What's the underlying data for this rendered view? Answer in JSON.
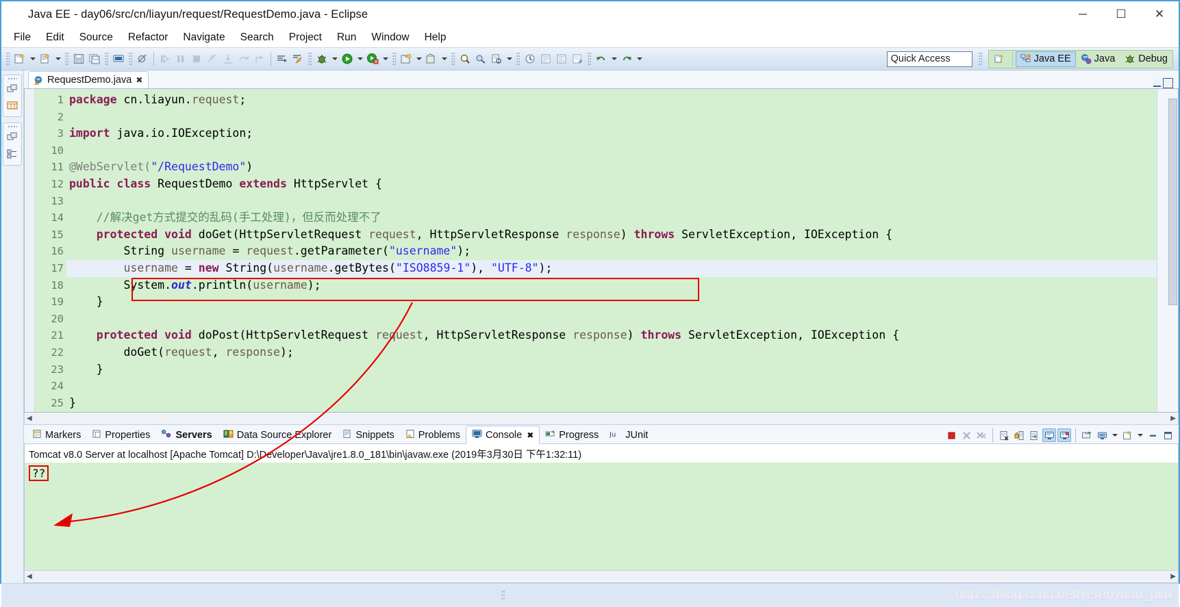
{
  "window": {
    "title": "Java EE - day06/src/cn/liayun/request/RequestDemo.java - Eclipse",
    "icon": "eclipse-icon",
    "minimize": "─",
    "maximize": "☐",
    "close": "✕"
  },
  "menu": {
    "items": [
      "File",
      "Edit",
      "Source",
      "Refactor",
      "Navigate",
      "Search",
      "Project",
      "Run",
      "Window",
      "Help"
    ]
  },
  "toolbar": {
    "quick_access_placeholder": "Quick Access",
    "quick_access_value": "",
    "open_perspective_icon": "open-perspective-icon",
    "perspectives": [
      {
        "label": "Java EE",
        "icon": "java-ee-perspective-icon",
        "active": true
      },
      {
        "label": "Java",
        "icon": "java-perspective-icon",
        "active": false
      },
      {
        "label": "Debug",
        "icon": "debug-perspective-icon",
        "active": false
      }
    ]
  },
  "editor": {
    "tab": {
      "label": "RequestDemo.java",
      "close": "✖",
      "icon": "java-file-warning-icon"
    },
    "minimize": "minimize-icon",
    "maximize": "maximize-icon",
    "current_line": 17,
    "lines": [
      {
        "n": "1",
        "fold": "",
        "text": "package cn.liayun.request;"
      },
      {
        "n": "2",
        "fold": "",
        "text": ""
      },
      {
        "n": "3",
        "fold": "+",
        "text": "import java.io.IOException;"
      },
      {
        "n": "10",
        "fold": "",
        "text": ""
      },
      {
        "n": "11",
        "fold": "",
        "text": "@WebServlet(\"/RequestDemo\")"
      },
      {
        "n": "12",
        "fold": "",
        "text": "public class RequestDemo extends HttpServlet {"
      },
      {
        "n": "13",
        "fold": "",
        "text": ""
      },
      {
        "n": "14",
        "fold": "",
        "text": "    //解决get方式提交的乱码(手工处理)，但反而处理不了"
      },
      {
        "n": "15",
        "fold": "-",
        "text": "    protected void doGet(HttpServletRequest request, HttpServletResponse response) throws ServletException, IOException {"
      },
      {
        "n": "16",
        "fold": "",
        "text": "        String username = request.getParameter(\"username\");"
      },
      {
        "n": "17",
        "fold": "",
        "text": "        username = new String(username.getBytes(\"ISO8859-1\"), \"UTF-8\");"
      },
      {
        "n": "18",
        "fold": "",
        "text": "        System.out.println(username);"
      },
      {
        "n": "19",
        "fold": "",
        "text": "    }"
      },
      {
        "n": "20",
        "fold": "",
        "text": ""
      },
      {
        "n": "21",
        "fold": "-",
        "text": "    protected void doPost(HttpServletRequest request, HttpServletResponse response) throws ServletException, IOException {"
      },
      {
        "n": "22",
        "fold": "",
        "text": "        doGet(request, response);"
      },
      {
        "n": "23",
        "fold": "",
        "text": "    }"
      },
      {
        "n": "24",
        "fold": "",
        "text": ""
      },
      {
        "n": "25",
        "fold": "",
        "text": "}"
      }
    ]
  },
  "bottom_panel": {
    "tabs": [
      {
        "label": "Markers",
        "icon": "markers-icon",
        "active": false,
        "bold": false
      },
      {
        "label": "Properties",
        "icon": "properties-icon",
        "active": false,
        "bold": false
      },
      {
        "label": "Servers",
        "icon": "servers-icon",
        "active": false,
        "bold": true
      },
      {
        "label": "Data Source Explorer",
        "icon": "data-source-explorer-icon",
        "active": false,
        "bold": false
      },
      {
        "label": "Snippets",
        "icon": "snippets-icon",
        "active": false,
        "bold": false
      },
      {
        "label": "Problems",
        "icon": "problems-icon",
        "active": false,
        "bold": false
      },
      {
        "label": "Console",
        "icon": "console-icon",
        "active": true,
        "bold": false
      },
      {
        "label": "Progress",
        "icon": "progress-icon",
        "active": false,
        "bold": false
      },
      {
        "label": "JUnit",
        "icon": "junit-icon",
        "active": false,
        "bold": false
      }
    ],
    "tools": [
      {
        "name": "terminate-icon",
        "on": false
      },
      {
        "name": "remove-launch-icon",
        "on": false
      },
      {
        "name": "remove-all-terminated-icon",
        "on": false
      },
      {
        "name": "clear-console-icon",
        "on": false
      },
      {
        "name": "scroll-lock-icon",
        "on": false
      },
      {
        "name": "word-wrap-icon",
        "on": false
      },
      {
        "name": "show-console-on-output-icon",
        "on": true
      },
      {
        "name": "show-console-on-error-icon",
        "on": true
      },
      {
        "name": "pin-console-icon",
        "on": false
      },
      {
        "name": "display-selected-console-icon",
        "on": false
      },
      {
        "name": "open-console-icon",
        "on": false
      },
      {
        "name": "minimize-icon",
        "on": false
      },
      {
        "name": "maximize-icon",
        "on": false
      }
    ]
  },
  "console": {
    "header": "Tomcat v8.0 Server at localhost [Apache Tomcat] D:\\Developer\\Java\\jre1.8.0_181\\bin\\javaw.exe (2019年3月30日 下午1:32:11)",
    "output": "??"
  },
  "status_bar": {
    "watermark": "https://blog.csdn.net/yerenyuan_pku"
  },
  "annotations": {
    "highlight_color": "#e60000",
    "code_box_label": "red-box-around-line-17",
    "console_box_label": "red-box-around-console-output",
    "arrow_label": "red-arrow-from-line-17-to-console-output"
  }
}
